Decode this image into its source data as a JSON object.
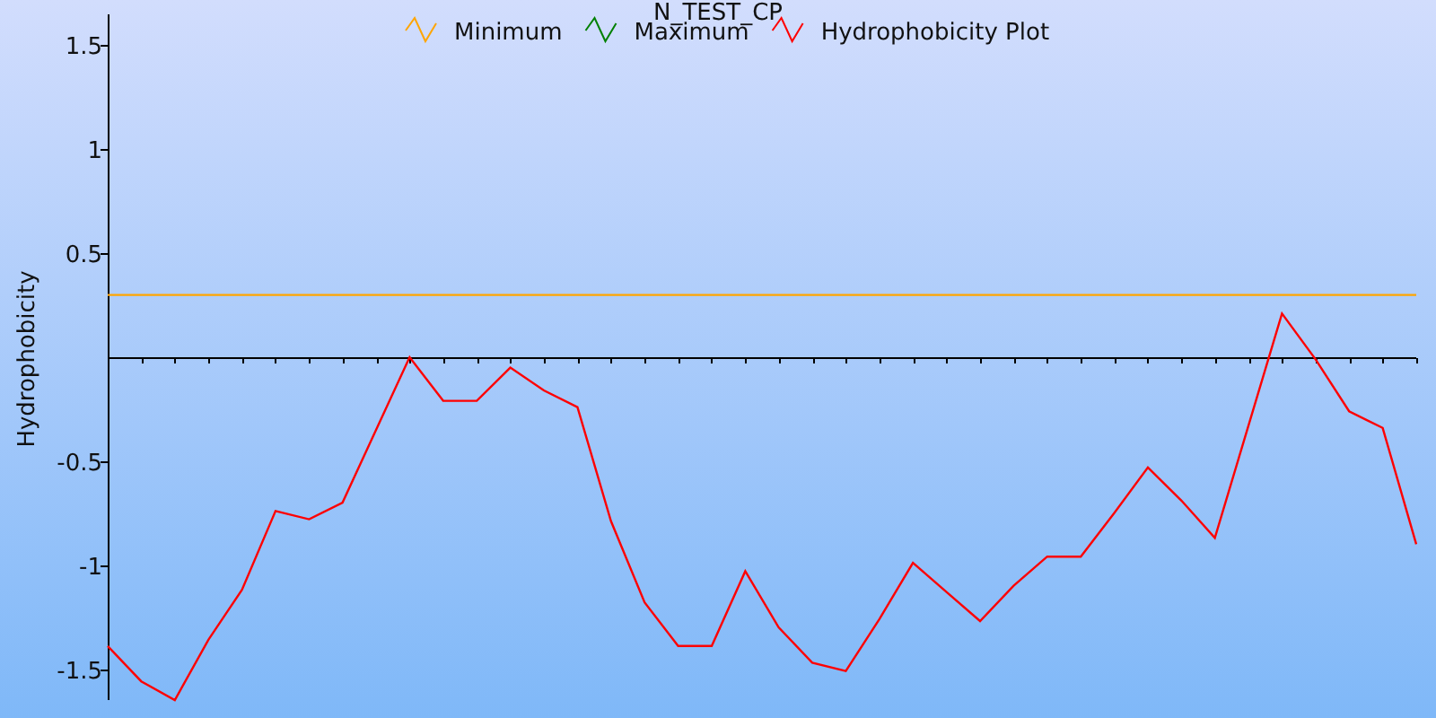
{
  "chart": {
    "chart_data": {
      "type": "line",
      "title": "N_TEST_CP",
      "ylabel": "Hydrophobicity",
      "categories": [
        null,
        null,
        null,
        null,
        null,
        null,
        null,
        null,
        null,
        null,
        null,
        null,
        null,
        null,
        null,
        null,
        null,
        null,
        null,
        null,
        null,
        null,
        null,
        null,
        null,
        null,
        null,
        null,
        null,
        null,
        null,
        null,
        null,
        null,
        null,
        null,
        null,
        null,
        null,
        null
      ],
      "series": [
        {
          "name": "Minimum",
          "color": "#ffa500",
          "values": [
            0.3,
            0.3,
            0.3,
            0.3,
            0.3,
            0.3,
            0.3,
            0.3,
            0.3,
            0.3,
            0.3,
            0.3,
            0.3,
            0.3,
            0.3,
            0.3,
            0.3,
            0.3,
            0.3,
            0.3,
            0.3,
            0.3,
            0.3,
            0.3,
            0.3,
            0.3,
            0.3,
            0.3,
            0.3,
            0.3,
            0.3,
            0.3,
            0.3,
            0.3,
            0.3,
            0.3,
            0.3,
            0.3,
            0.3,
            0.3
          ]
        },
        {
          "name": "Maximum",
          "color": "#008000",
          "values": [
            null,
            null,
            null,
            null,
            null,
            null,
            null,
            null,
            null,
            null,
            null,
            null,
            null,
            null,
            null,
            null,
            null,
            null,
            null,
            null,
            null,
            null,
            null,
            null,
            null,
            null,
            null,
            null,
            null,
            null,
            null,
            null,
            null,
            null,
            null,
            null,
            null,
            null,
            null,
            null
          ]
        },
        {
          "name": "Hydrophobicity Plot",
          "color": "#ff0000",
          "values": [
            -1.39,
            -1.56,
            -1.65,
            -1.36,
            -1.12,
            -0.74,
            -0.78,
            -0.7,
            -0.35,
            0.0,
            -0.21,
            -0.21,
            -0.05,
            -0.16,
            -0.24,
            -0.79,
            -1.18,
            -1.39,
            -1.39,
            -1.03,
            -1.3,
            -1.47,
            -1.51,
            -1.26,
            -0.99,
            -1.13,
            -1.27,
            -1.1,
            -0.96,
            -0.96,
            -0.75,
            -0.53,
            -0.69,
            -0.87,
            -0.33,
            0.21,
            -0.01,
            -0.26,
            -0.34,
            -0.9
          ]
        }
      ],
      "legend": "top",
      "ylim": [
        -1.65,
        1.65
      ],
      "yticks": [
        -1.5,
        -1,
        -0.5,
        0.5,
        1,
        1.5
      ]
    }
  }
}
